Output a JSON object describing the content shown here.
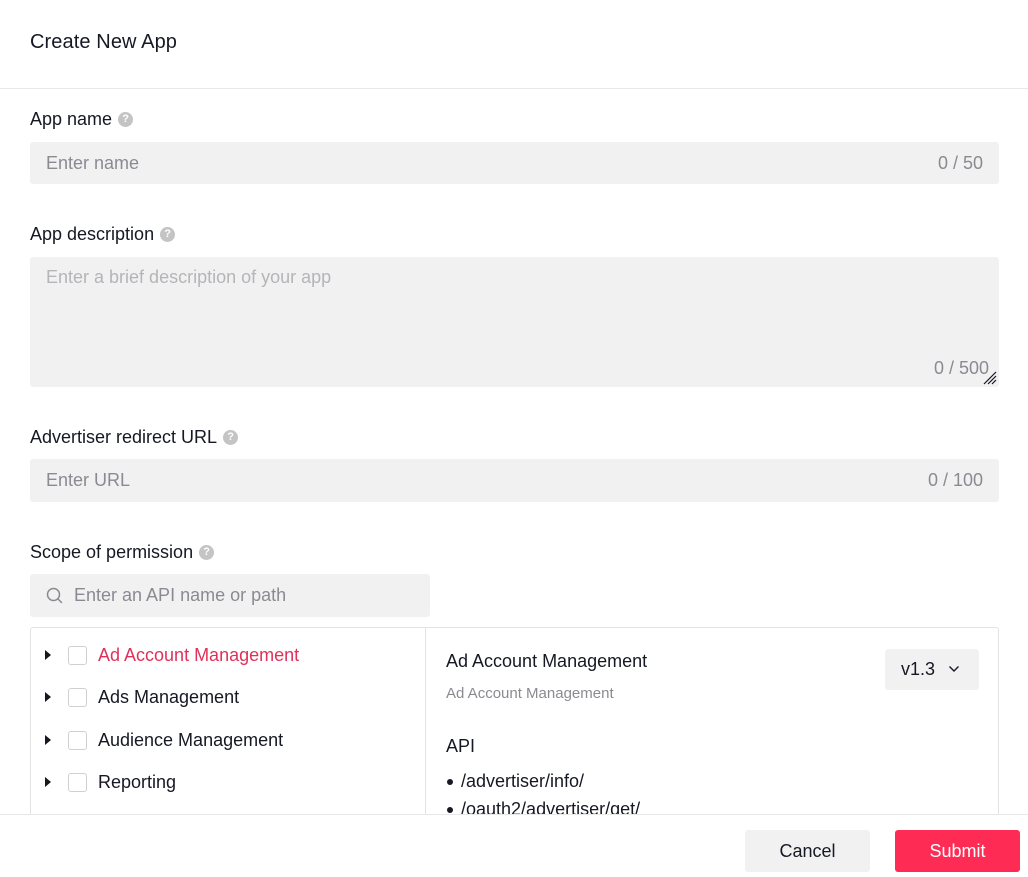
{
  "dialog": {
    "title": "Create New App"
  },
  "form": {
    "app_name": {
      "label": "App name",
      "placeholder": "Enter name",
      "value": "",
      "counter": "0 / 50"
    },
    "app_description": {
      "label": "App description",
      "placeholder": "Enter a brief description of your app",
      "value": "",
      "counter": "0 / 500"
    },
    "redirect_url": {
      "label": "Advertiser redirect URL",
      "placeholder": "Enter URL",
      "value": "",
      "counter": "0 / 100"
    },
    "scope": {
      "label": "Scope of permission",
      "search_placeholder": "Enter an API name or path",
      "search_value": "",
      "items": [
        {
          "label": "Ad Account Management",
          "active": true,
          "checked": false
        },
        {
          "label": "Ads Management",
          "active": false,
          "checked": false
        },
        {
          "label": "Audience Management",
          "active": false,
          "checked": false
        },
        {
          "label": "Reporting",
          "active": false,
          "checked": false
        }
      ]
    }
  },
  "detail": {
    "title": "Ad Account Management",
    "subtitle": "Ad Account Management",
    "version": "v1.3",
    "api_heading": "API",
    "apis": [
      "/advertiser/info/",
      "/oauth2/advertiser/get/"
    ]
  },
  "footer": {
    "cancel_label": "Cancel",
    "submit_label": "Submit"
  },
  "icons": {
    "help": "question-icon",
    "search": "search-icon",
    "caret": "caret-right-icon",
    "dropdown": "chevron-down-icon",
    "resize": "resize-handle-icon"
  },
  "colors": {
    "accent": "#fe2c55",
    "active_text": "#e1305a",
    "field_bg": "#f1f1f2"
  }
}
